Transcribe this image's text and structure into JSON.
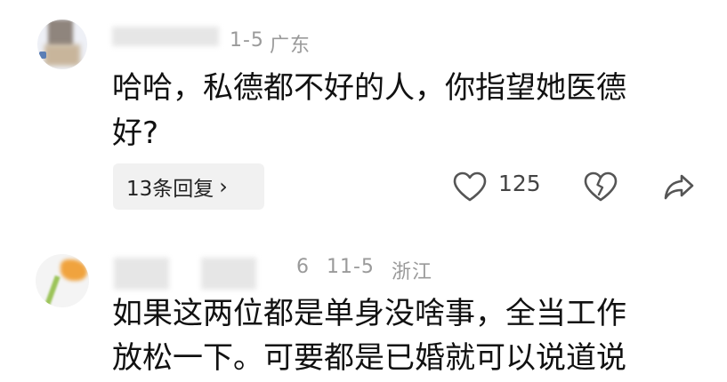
{
  "comments": [
    {
      "meta_date": "1-5",
      "meta_location": "广东",
      "text_line1": "哈哈，私德都不好的人，你指望她医德",
      "text_line2": "好?",
      "replies_label": "13条回复",
      "like_count": "125",
      "icons": [
        "heart-icon",
        "broken-heart-icon",
        "share-icon",
        "chevron-right-icon"
      ]
    },
    {
      "meta_prefix": "6",
      "meta_date": "11-5",
      "meta_location": "浙江",
      "text_line1": "如果这两位都是单身没啥事，全当工作",
      "text_line2": "放松一下。可要都是已婚就可以说道说"
    }
  ],
  "colors": {
    "text": "#111111",
    "meta": "#9a9a9a",
    "reply_bg": "#f1f1f1"
  }
}
